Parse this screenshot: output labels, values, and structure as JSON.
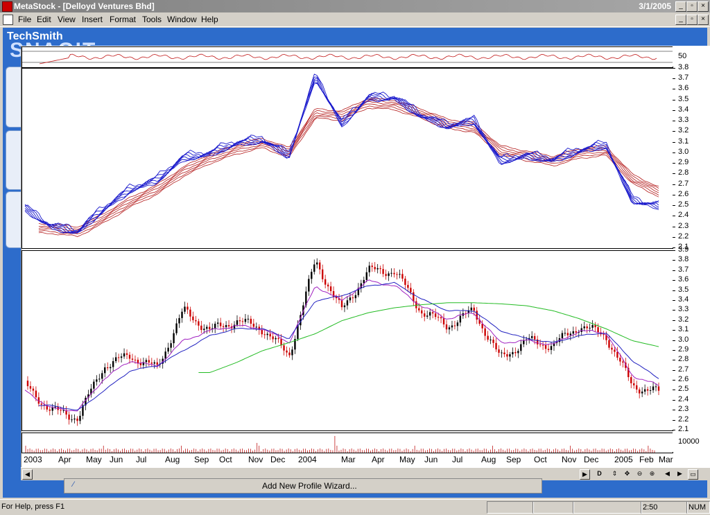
{
  "window": {
    "title": "MetaStock - [Delloyd Ventures Bhd]",
    "date": "3/1/2005"
  },
  "menu": [
    "File",
    "Edit",
    "View",
    "Insert",
    "Format",
    "Tools",
    "Window",
    "Help"
  ],
  "background_app": {
    "brand_line1": "TechSmith",
    "brand_line2": "SNAGIT"
  },
  "axes": {
    "indicator_tick": "50",
    "gmma_ticks": [
      "3.8",
      "3.7",
      "3.6",
      "3.5",
      "3.4",
      "3.3",
      "3.2",
      "3.1",
      "3.0",
      "2.9",
      "2.8",
      "2.7",
      "2.6",
      "2.5",
      "2.4",
      "2.3",
      "2.2",
      "2.1"
    ],
    "price_ticks": [
      "3.9",
      "3.8",
      "3.7",
      "3.6",
      "3.5",
      "3.4",
      "3.3",
      "3.2",
      "3.1",
      "3.0",
      "2.9",
      "2.8",
      "2.7",
      "2.6",
      "2.5",
      "2.4",
      "2.3",
      "2.2",
      "2.1"
    ],
    "volume_tick": "10000"
  },
  "x_axis_labels": [
    "2003",
    "Apr",
    "May",
    "Jun",
    "Jul",
    "Aug",
    "Sep",
    "Oct",
    "Nov",
    "Dec",
    "2004",
    "Mar",
    "Apr",
    "May",
    "Jun",
    "Jul",
    "Aug",
    "Sep",
    "Oct",
    "Nov",
    "Dec",
    "2005",
    "Feb",
    "Mar"
  ],
  "chart_data": [
    {
      "type": "line",
      "name": "Multiple moving averages (short and long groups)",
      "x": [
        "2003-02",
        "2003-03",
        "2003-04",
        "2003-05",
        "2003-06",
        "2003-07",
        "2003-08",
        "2003-09",
        "2003-10",
        "2003-11",
        "2003-12",
        "2004-01",
        "2004-02",
        "2004-03",
        "2004-04",
        "2004-05",
        "2004-06",
        "2004-07",
        "2004-08",
        "2004-09",
        "2004-10",
        "2004-11",
        "2004-12",
        "2005-01",
        "2005-02"
      ],
      "series": [
        {
          "group": "short",
          "values": [
            2.5,
            2.33,
            2.28,
            2.5,
            2.68,
            2.77,
            2.98,
            3.02,
            3.12,
            3.15,
            3.0,
            3.75,
            3.3,
            3.55,
            3.55,
            3.38,
            3.28,
            3.33,
            2.95,
            3.0,
            2.96,
            3.05,
            3.1,
            2.58,
            2.52
          ]
        },
        {
          "group": "long",
          "values": [
            null,
            2.33,
            2.3,
            2.43,
            2.58,
            2.7,
            2.87,
            2.99,
            3.08,
            3.14,
            3.05,
            3.42,
            3.4,
            3.52,
            3.5,
            3.42,
            3.32,
            3.29,
            3.07,
            3.02,
            2.97,
            3.04,
            3.07,
            2.8,
            2.68
          ]
        }
      ],
      "ylim": [
        2.1,
        3.8
      ]
    },
    {
      "type": "line",
      "name": "Price with moving averages",
      "x": [
        "2003-02",
        "2003-03",
        "2003-04",
        "2003-05",
        "2003-06",
        "2003-07",
        "2003-08",
        "2003-09",
        "2003-10",
        "2003-11",
        "2003-12",
        "2004-01",
        "2004-02",
        "2004-03",
        "2004-04",
        "2004-05",
        "2004-06",
        "2004-07",
        "2004-08",
        "2004-09",
        "2004-10",
        "2004-11",
        "2004-12",
        "2005-01",
        "2005-02"
      ],
      "series": [
        {
          "name": "close",
          "values": [
            2.55,
            2.3,
            2.23,
            2.75,
            2.85,
            2.72,
            3.3,
            3.1,
            3.2,
            3.12,
            2.85,
            3.8,
            3.3,
            3.7,
            3.7,
            3.3,
            3.15,
            3.3,
            2.82,
            3.0,
            2.95,
            3.15,
            3.05,
            2.55,
            2.48
          ]
        },
        {
          "name": "ma_short",
          "values": [
            2.5,
            2.32,
            2.3,
            2.62,
            2.8,
            2.74,
            3.0,
            3.1,
            3.15,
            3.12,
            2.98,
            3.55,
            3.4,
            3.6,
            3.55,
            3.35,
            3.22,
            3.28,
            2.98,
            3.0,
            2.96,
            3.1,
            3.08,
            2.65,
            2.55
          ]
        },
        {
          "name": "ma_medium",
          "values": [
            null,
            2.35,
            2.3,
            2.5,
            2.7,
            2.75,
            2.9,
            3.05,
            3.12,
            3.12,
            3.02,
            3.4,
            3.45,
            3.55,
            3.58,
            3.42,
            3.3,
            3.3,
            3.1,
            3.02,
            2.98,
            3.05,
            3.08,
            2.8,
            2.62
          ]
        },
        {
          "name": "ma_long",
          "values": [
            null,
            null,
            null,
            null,
            null,
            null,
            null,
            2.68,
            2.78,
            2.9,
            2.98,
            3.07,
            3.2,
            3.28,
            3.33,
            3.36,
            3.38,
            3.38,
            3.37,
            3.35,
            3.3,
            3.22,
            3.12,
            3.0,
            2.94
          ]
        }
      ],
      "ylim": [
        2.1,
        3.9
      ]
    },
    {
      "type": "bar",
      "name": "Volume",
      "ylim": [
        0,
        10000
      ]
    }
  ],
  "scroll_buttons": [
    "D"
  ],
  "wizard": {
    "label": "Add New Profile Wizard..."
  },
  "status": {
    "help": "For Help, press F1",
    "time": "2:50",
    "num": "NUM"
  },
  "colors": {
    "short_ma": "#1a1acc",
    "long_ma": "#b31a1a",
    "ma_medium": "#2020c0",
    "ma_fast": "#a020c0",
    "ma_long": "#22bb22",
    "candle_up": "#000000",
    "candle_down": "#cc0000"
  }
}
